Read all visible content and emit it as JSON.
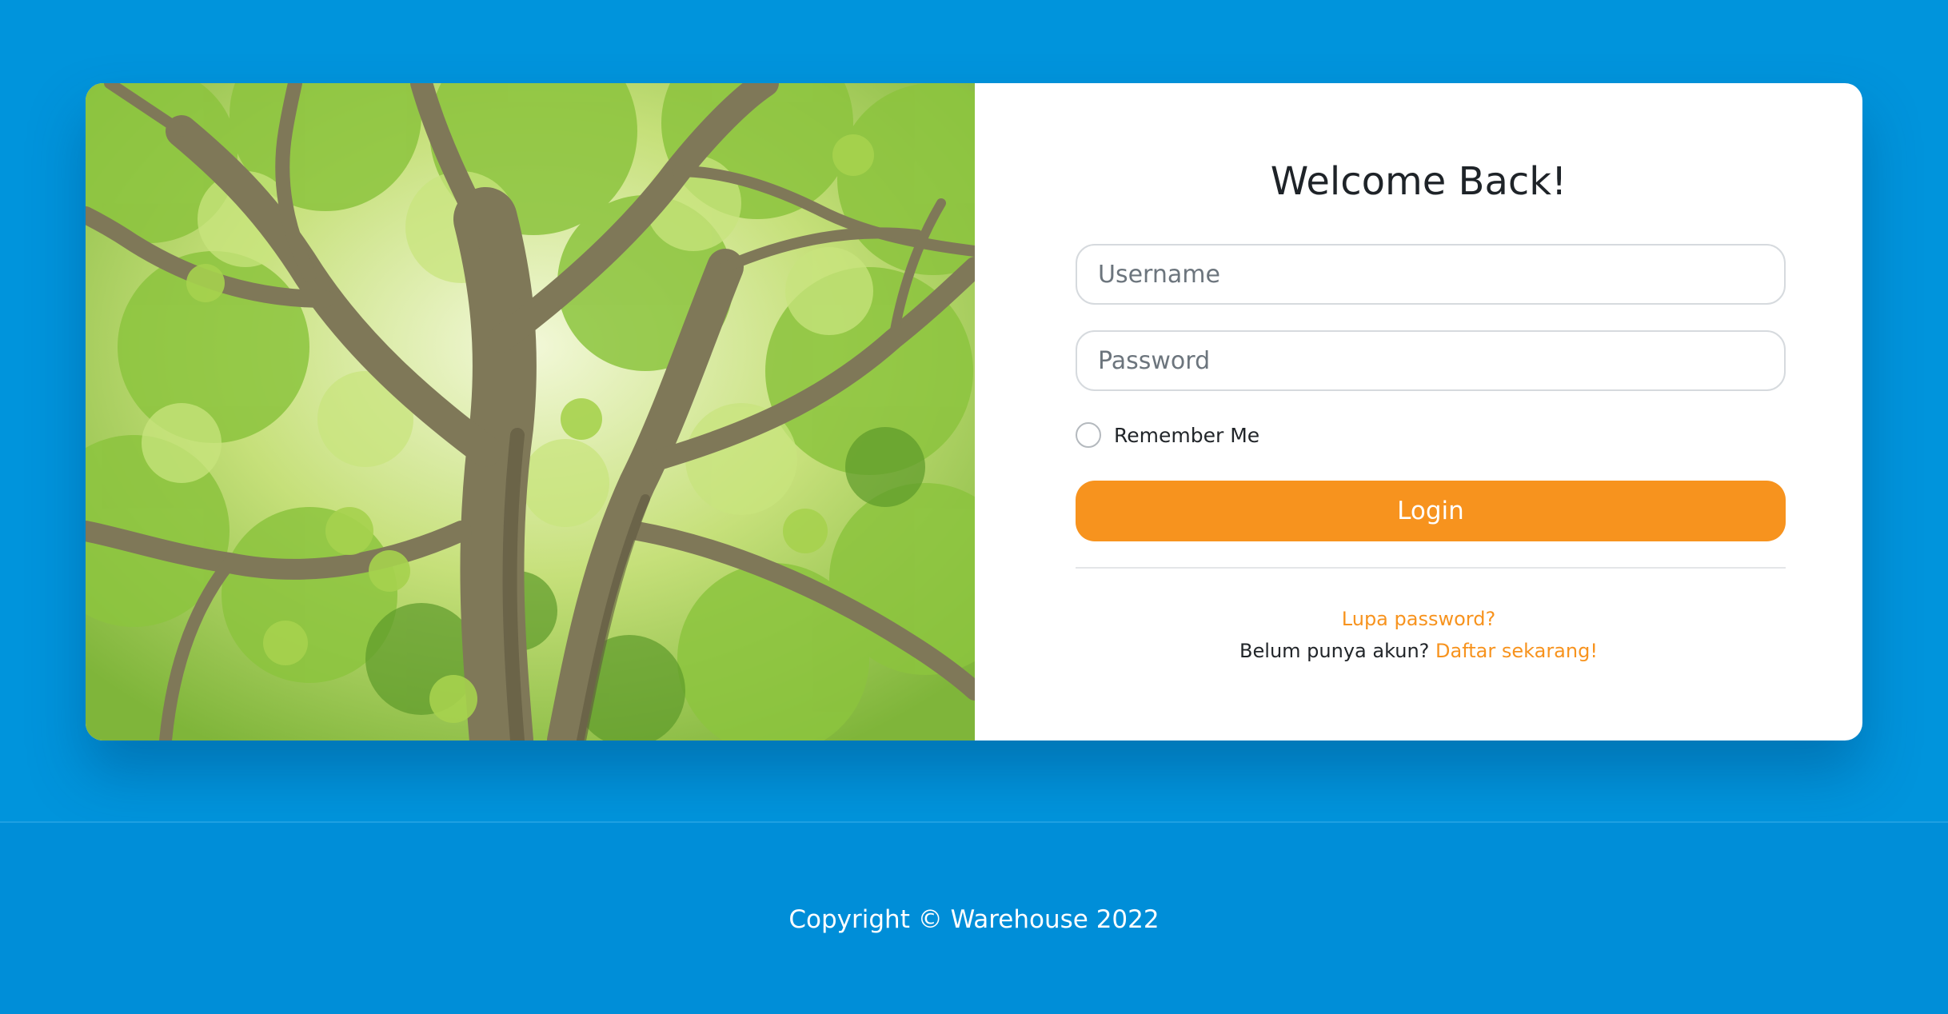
{
  "login": {
    "title": "Welcome Back!",
    "username_placeholder": "Username",
    "password_placeholder": "Password",
    "remember_label": "Remember Me",
    "login_label": "Login",
    "forgot_link": "Lupa password?",
    "register_prompt": "Belum punya akun?",
    "register_link": "Daftar sekarang!"
  },
  "footer": {
    "copyright": "Copyright © Warehouse 2022"
  },
  "colors": {
    "background": "#0094dc",
    "accent": "#f7931e",
    "card": "#ffffff"
  },
  "icons": {
    "hero_image": "tree-canopy-image"
  }
}
